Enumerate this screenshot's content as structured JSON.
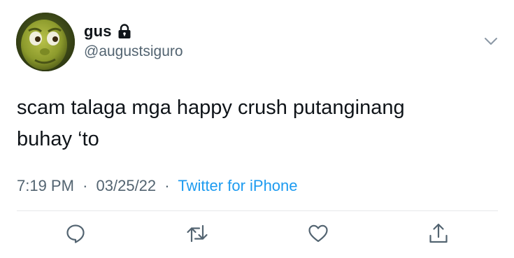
{
  "tweet": {
    "display_name": "gus",
    "handle": "@augustsiguro",
    "text_line1": "scam talaga mga happy crush putanginang",
    "text_line2": "buhay ‘to",
    "time": "7:19 PM",
    "date": "03/25/22",
    "separator": "·",
    "source": "Twitter for iPhone"
  },
  "icons": {
    "lock": "lock-icon",
    "caret": "chevron-down-icon",
    "reply": "reply-icon",
    "retweet": "retweet-icon",
    "like": "heart-icon",
    "share": "share-icon"
  },
  "colors": {
    "text": "#0f1419",
    "secondary": "#536471",
    "link": "#1d9bf0",
    "divider": "#e7e9ea"
  }
}
